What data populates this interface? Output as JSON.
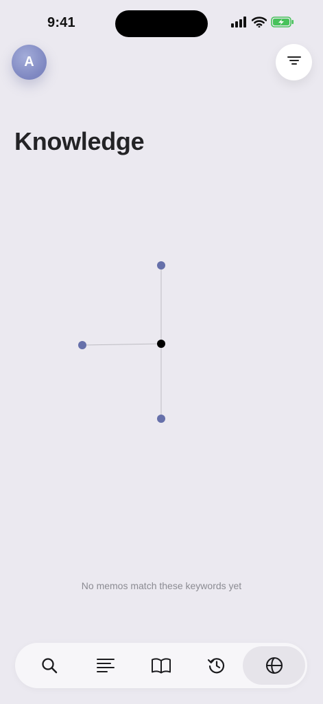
{
  "status_bar": {
    "time": "9:41",
    "icons": [
      "signal-icon",
      "wifi-icon",
      "battery-charging-icon"
    ]
  },
  "header": {
    "avatar_initial": "A",
    "filter_icon": "filter-lines-icon"
  },
  "page": {
    "title": "Knowledge"
  },
  "graph": {
    "nodes": [
      {
        "id": "center",
        "color": "#000000"
      },
      {
        "id": "top",
        "color": "#6670aa"
      },
      {
        "id": "left",
        "color": "#6670aa"
      },
      {
        "id": "bottom",
        "color": "#6670aa"
      }
    ],
    "edges": [
      [
        "center",
        "top"
      ],
      [
        "center",
        "left"
      ],
      [
        "center",
        "bottom"
      ]
    ],
    "edge_color": "#bdbcc2"
  },
  "empty_state": {
    "message": "No memos match these keywords yet"
  },
  "tab_bar": {
    "tabs": [
      {
        "icon": "search-icon",
        "active": false
      },
      {
        "icon": "list-icon",
        "active": false
      },
      {
        "icon": "book-icon",
        "active": false
      },
      {
        "icon": "history-icon",
        "active": false
      },
      {
        "icon": "globe-icon",
        "active": true
      }
    ]
  },
  "colors": {
    "background": "#ebe9f0",
    "accent": "#7f88c1",
    "text": "#232326"
  }
}
